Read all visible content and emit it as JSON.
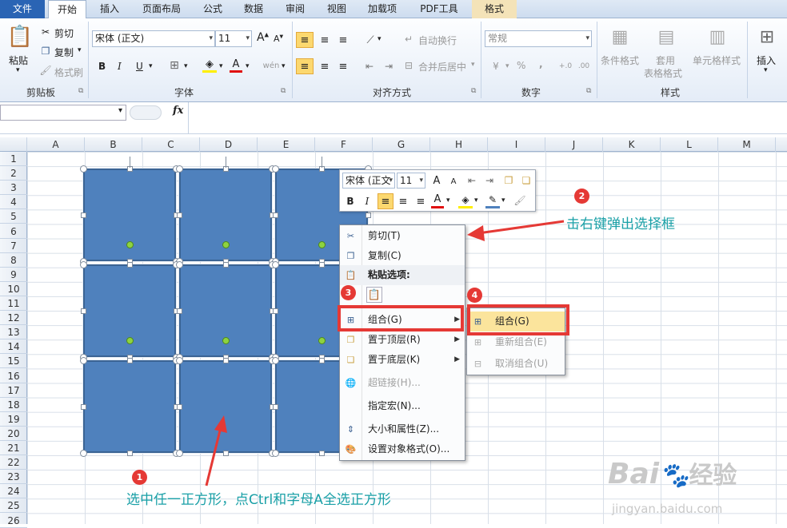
{
  "tabs": [
    "文件",
    "开始",
    "插入",
    "页面布局",
    "公式",
    "数据",
    "审阅",
    "视图",
    "加载项",
    "PDF工具",
    "格式"
  ],
  "clipboard": {
    "paste": "粘贴",
    "cut": "剪切",
    "copy": "复制",
    "format_painter": "格式刷",
    "label": "剪贴板"
  },
  "font": {
    "name": "宋体 (正文)",
    "size": "11",
    "bold": "B",
    "italic": "I",
    "underline": "U",
    "label": "字体",
    "grow": "A",
    "shrink": "A",
    "pinyin": "wén"
  },
  "align": {
    "wrap": "自动换行",
    "merge": "合并后居中",
    "label": "对齐方式"
  },
  "number": {
    "format": "常规",
    "percent": "%",
    "comma": ",",
    "label": "数字"
  },
  "styles": {
    "cond": "条件格式",
    "table1": "套用",
    "table2": "表格格式",
    "cell": "单元格样式",
    "label": "样式"
  },
  "insert": {
    "label": "插入"
  },
  "formula": {
    "fx": "fx"
  },
  "columns": [
    "A",
    "B",
    "C",
    "D",
    "E",
    "F",
    "G",
    "H",
    "I",
    "J",
    "K",
    "L",
    "M"
  ],
  "rows": [
    "1",
    "2",
    "3",
    "4",
    "5",
    "6",
    "7",
    "8",
    "9",
    "10",
    "11",
    "12",
    "13",
    "14",
    "15",
    "16",
    "17",
    "18",
    "19",
    "20",
    "21",
    "22",
    "23",
    "24",
    "25",
    "26"
  ],
  "mini_toolbar": {
    "font": "宋体 (正文",
    "size": "11"
  },
  "context_menu": {
    "cut": "剪切(T)",
    "copy": "复制(C)",
    "paste_options": "粘贴选项:",
    "group": "组合(G)",
    "bring_front": "置于顶层(R)",
    "send_back": "置于底层(K)",
    "hyperlink": "超链接(H)...",
    "assign_macro": "指定宏(N)...",
    "size_props": "大小和属性(Z)...",
    "format_object": "设置对象格式(O)..."
  },
  "submenu": {
    "group": "组合(G)",
    "regroup": "重新组合(E)",
    "ungroup": "取消组合(U)"
  },
  "annotations": {
    "n1": "1",
    "n2": "2",
    "n3": "3",
    "n4": "4",
    "step1": "选中任一正方形，点Ctrl和字母A全选正方形",
    "step2": "击右键弹出选择框"
  },
  "watermark": {
    "brand": "Bai",
    "brand_suffix": "经验",
    "site": "jingyan.baidu.com"
  },
  "colors": {
    "accent_red": "#e53935",
    "shape_fill": "#4f81bd",
    "annot_text": "#1aa0a7"
  }
}
